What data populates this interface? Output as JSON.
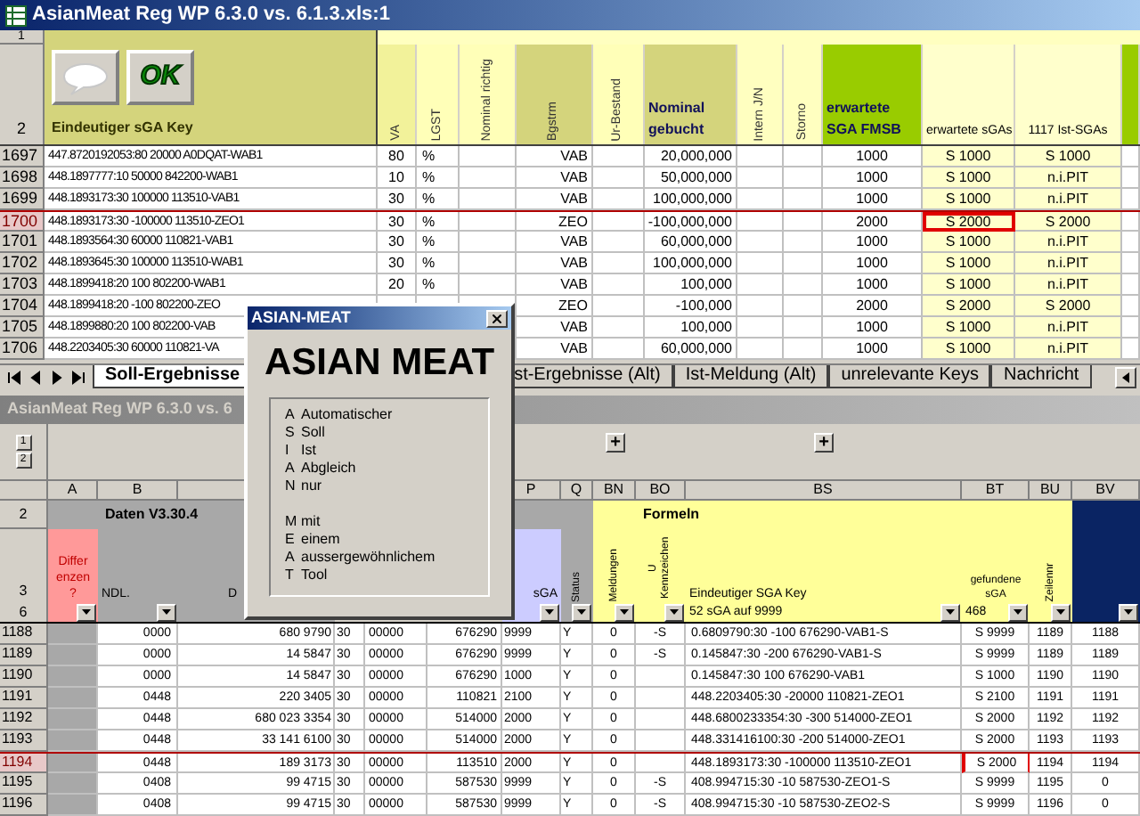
{
  "top_window": {
    "title": "AsianMeat Reg WP 6.3.0 vs. 6.1.3.xls:1",
    "row_headers": [
      "1",
      "2"
    ],
    "buttons": [
      {
        "kind": "comment"
      },
      {
        "kind": "ok",
        "label": "OK"
      }
    ],
    "columns": [
      {
        "kind": "key",
        "label": "Eindeutiger sGA Key",
        "color": "#d4d47c"
      },
      {
        "label": "VA",
        "rotated": true,
        "color": "#f2f29a"
      },
      {
        "label": "LGST",
        "rotated": true,
        "color": "#ffffb8"
      },
      {
        "label": "Nominal richtig",
        "rotated": true,
        "color": "#ffffb8"
      },
      {
        "label": "Bgstrm",
        "rotated": true,
        "color": "#d4d47c"
      },
      {
        "label": "Ur-Bestand",
        "rotated": true,
        "color": "#ffffb8"
      },
      {
        "label": "Nominal gebucht",
        "rotated": false,
        "bold": true,
        "color": "#d4d47c"
      },
      {
        "label": "Intern J/N",
        "rotated": true,
        "color": "#ffffc0"
      },
      {
        "label": "Storno",
        "rotated": true,
        "color": "#ffffc0"
      },
      {
        "label": "erwartete SGA FMSB",
        "rotated": false,
        "bold": true,
        "color": "#99cc00"
      },
      {
        "label": "erwartete sGAs",
        "rotated": false,
        "shaded": true,
        "highlight": true,
        "color": "#ffffcc"
      },
      {
        "label": "1117 Ist-SGAs",
        "rotated": false,
        "shaded": true,
        "color": "#ffffcc"
      },
      {
        "color": "#99cc00"
      }
    ],
    "rows": [
      {
        "number": "1697",
        "selected": false,
        "cells": [
          "447.8720192053:80 20000 A0DQAT-WAB1",
          "80",
          "%",
          null,
          "VAB",
          null,
          "20,000,000",
          null,
          null,
          "1000",
          "S 1000",
          "S 1000"
        ]
      },
      {
        "number": "1698",
        "selected": false,
        "cells": [
          "448.1897777:10 50000 842200-WAB1",
          "10",
          "%",
          null,
          "VAB",
          null,
          "50,000,000",
          null,
          null,
          "1000",
          "S 1000",
          "n.i.PIT"
        ]
      },
      {
        "number": "1699",
        "selected": false,
        "cells": [
          "448.1893173:30 100000 113510-VAB1",
          "30",
          "%",
          null,
          "VAB",
          null,
          "100,000,000",
          null,
          null,
          "1000",
          "S 1000",
          "n.i.PIT"
        ]
      },
      {
        "number": "1700",
        "selected": true,
        "cells": [
          "448.1893173:30 -100000 113510-ZEO1",
          "30",
          "%",
          null,
          "ZEO",
          null,
          "-100,000,000",
          null,
          null,
          "2000",
          "S 2000",
          "S 2000"
        ]
      },
      {
        "number": "1701",
        "selected": false,
        "cells": [
          "448.1893564:30 60000 110821-VAB1",
          "30",
          "%",
          null,
          "VAB",
          null,
          "60,000,000",
          null,
          null,
          "1000",
          "S 1000",
          "n.i.PIT"
        ]
      },
      {
        "number": "1702",
        "selected": false,
        "cells": [
          "448.1893645:30 100000 113510-WAB1",
          "30",
          "%",
          null,
          "VAB",
          null,
          "100,000,000",
          null,
          null,
          "1000",
          "S 1000",
          "n.i.PIT"
        ]
      },
      {
        "number": "1703",
        "selected": false,
        "cells": [
          "448.1899418:20 100 802200-WAB1",
          "20",
          "%",
          null,
          "VAB",
          null,
          "100,000",
          null,
          null,
          "1000",
          "S 1000",
          "n.i.PIT"
        ]
      },
      {
        "number": "1704",
        "selected": false,
        "cells": [
          "448.1899418:20 -100 802200-ZEO",
          null,
          null,
          null,
          "ZEO",
          null,
          "-100,000",
          null,
          null,
          "2000",
          "S 2000",
          "S 2000"
        ]
      },
      {
        "number": "1705",
        "selected": false,
        "cells": [
          "448.1899880:20 100 802200-VAB",
          null,
          null,
          null,
          "VAB",
          null,
          "100,000",
          null,
          null,
          "1000",
          "S 1000",
          "n.i.PIT"
        ]
      },
      {
        "number": "1706",
        "selected": false,
        "cells": [
          "448.2203405:30 60000 110821-VA",
          null,
          null,
          null,
          "VAB",
          null,
          "60,000,000",
          null,
          null,
          "1000",
          "S 1000",
          "n.i.PIT"
        ]
      }
    ],
    "sheet_tabs": [
      {
        "label": "Soll-Ergebnisse",
        "selected": true
      },
      {
        "label": "st-Ergebnisse (Alt)",
        "selected": false
      },
      {
        "label": "Ist-Meldung (Alt)",
        "selected": false
      },
      {
        "label": "unrelevante Keys",
        "selected": false
      },
      {
        "label": "Nachricht",
        "selected": false
      }
    ]
  },
  "bottom_window": {
    "title": "AsianMeat Reg WP 6.3.0 vs. 6",
    "outline_levels": [
      "1",
      "2"
    ],
    "expand_buttons": [
      "+",
      "+"
    ],
    "header_rows": [
      "2",
      "3",
      "6"
    ],
    "columns": [
      {
        "letter": "A",
        "color": "#ff9999",
        "header": "Differenzen ?",
        "filter": true
      },
      {
        "letter": "B",
        "color": "#a8a8a8",
        "group": "Daten V3.30.4",
        "header": "NDL.",
        "filter": true
      },
      {
        "color": "#a8a8a8",
        "header": "D"
      },
      {},
      {},
      {},
      {
        "letter": "P",
        "color": "#ccccff",
        "header": "sGA",
        "filter": true
      },
      {
        "letter": "Q",
        "color": "#a8a8a8",
        "header": "Status",
        "rotated": true,
        "filter": true
      },
      {
        "letter": "BN",
        "color": "#ffff99",
        "header": "Meldungen",
        "rotated": true,
        "filter": true
      },
      {
        "letter": "BO",
        "color": "#ffff99",
        "group": "Formeln",
        "header": "U Kennzeichen",
        "rotated": true,
        "filter": true
      },
      {
        "letter": "BS",
        "color": "#ffff99",
        "header": "Eindeutiger SGA Key",
        "rotated": false,
        "filter": true,
        "filter_value": "52 sGA auf 9999"
      },
      {
        "letter": "BT",
        "color": "#ffff99",
        "header": "gefundene sGA",
        "rotated": false,
        "filter": true,
        "filter_value": "468",
        "highlight": true
      },
      {
        "letter": "BU",
        "color": "#ffff99",
        "header": "Zeilennr",
        "rotated": true,
        "filter": true
      },
      {
        "letter": "BV",
        "color": "#0a2463",
        "filter": true
      }
    ],
    "rows": [
      {
        "number": "1188",
        "selected": false,
        "cells": [
          null,
          "0000",
          "680 9790",
          "30",
          "00000",
          "676290",
          "9999",
          "Y",
          "0",
          "-S",
          "0.6809790:30 -100 676290-VAB1-S",
          "S 9999",
          "1189",
          "1188"
        ]
      },
      {
        "number": "1189",
        "selected": false,
        "cells": [
          null,
          "0000",
          "14 5847",
          "30",
          "00000",
          "676290",
          "9999",
          "Y",
          "0",
          "-S",
          "0.145847:30 -200 676290-VAB1-S",
          "S 9999",
          "1189",
          "1189"
        ]
      },
      {
        "number": "1190",
        "selected": false,
        "cells": [
          null,
          "0000",
          "14 5847",
          "30",
          "00000",
          "676290",
          "1000",
          "Y",
          "0",
          null,
          "0.145847:30 100 676290-VAB1",
          "S 1000",
          "1190",
          "1190"
        ]
      },
      {
        "number": "1191",
        "selected": false,
        "cells": [
          null,
          "0448",
          "220 3405",
          "30",
          "00000",
          "110821",
          "2100",
          "Y",
          "0",
          null,
          "448.2203405:30 -20000 110821-ZEO1",
          "S 2100",
          "1191",
          "1191"
        ]
      },
      {
        "number": "1192",
        "selected": false,
        "cells": [
          null,
          "0448",
          "680 023 3354",
          "30",
          "00000",
          "514000",
          "2000",
          "Y",
          "0",
          null,
          "448.6800233354:30 -300 514000-ZEO1",
          "S 2000",
          "1192",
          "1192"
        ]
      },
      {
        "number": "1193",
        "selected": false,
        "cells": [
          null,
          "0448",
          "33 141 6100",
          "30",
          "00000",
          "514000",
          "2000",
          "Y",
          "0",
          null,
          "448.331416100:30 -200 514000-ZEO1",
          "S 2000",
          "1193",
          "1193"
        ]
      },
      {
        "number": "1194",
        "selected": true,
        "cells": [
          null,
          "0448",
          "189 3173",
          "30",
          "00000",
          "113510",
          "2000",
          "Y",
          "0",
          null,
          "448.1893173:30 -100000 113510-ZEO1",
          "S 2000",
          "1194",
          "1194"
        ]
      },
      {
        "number": "1195",
        "selected": false,
        "cells": [
          null,
          "0408",
          "99 4715",
          "30",
          "00000",
          "587530",
          "9999",
          "Y",
          "0",
          "-S",
          "408.994715:30 -10 587530-ZEO1-S",
          "S 9999",
          "1195",
          "0"
        ]
      },
      {
        "number": "1196",
        "selected": false,
        "cells": [
          null,
          "0408",
          "99 4715",
          "30",
          "00000",
          "587530",
          "9999",
          "Y",
          "0",
          "-S",
          "408.994715:30 -10 587530-ZEO2-S",
          "S 9999",
          "1196",
          "0"
        ]
      }
    ]
  },
  "dialog": {
    "title": "ASIAN-MEAT",
    "heading": "ASIAN MEAT",
    "legend": [
      [
        {
          "letter": "A",
          "word": "Automatischer"
        },
        {
          "letter": "S",
          "word": "Soll"
        },
        {
          "letter": "I",
          "word": "Ist"
        },
        {
          "letter": "A",
          "word": "Abgleich"
        },
        {
          "letter": "N",
          "word": "nur"
        }
      ],
      [
        {
          "letter": "M",
          "word": "mit"
        },
        {
          "letter": "E",
          "word": "einem"
        },
        {
          "letter": "A",
          "word": "aussergewöhnlichem"
        },
        {
          "letter": "T",
          "word": "Tool"
        }
      ]
    ]
  }
}
